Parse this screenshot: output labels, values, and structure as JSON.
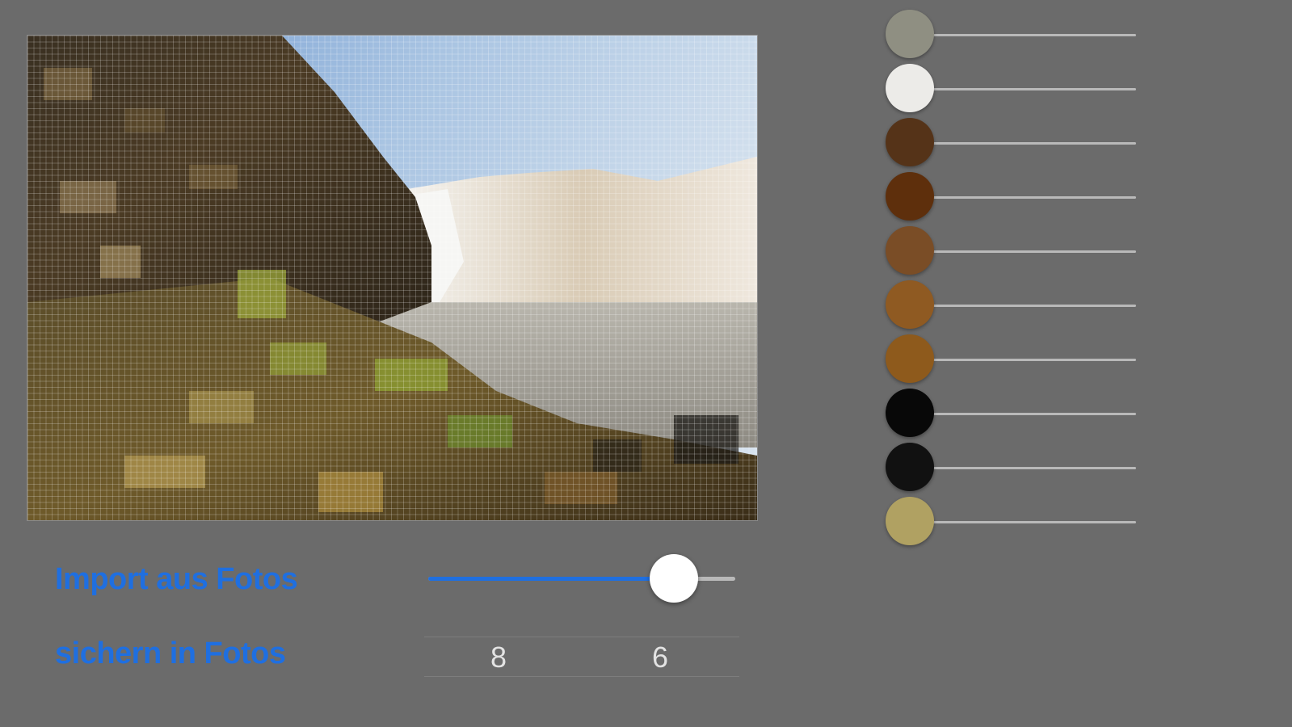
{
  "links": {
    "import_label": "Import aus Fotos",
    "save_label": "sichern in Fotos"
  },
  "slider": {
    "value": 0.8
  },
  "picker": {
    "value_a": "8",
    "value_b": "6"
  },
  "palette": {
    "colors": [
      "#8f8f82",
      "#ecebe8",
      "#553318",
      "#5e2f0c",
      "#7a4d26",
      "#8f5a22",
      "#8e5a1c",
      "#080808",
      "#111111",
      "#b0a162"
    ]
  },
  "accent_color": "#1f6fe0"
}
